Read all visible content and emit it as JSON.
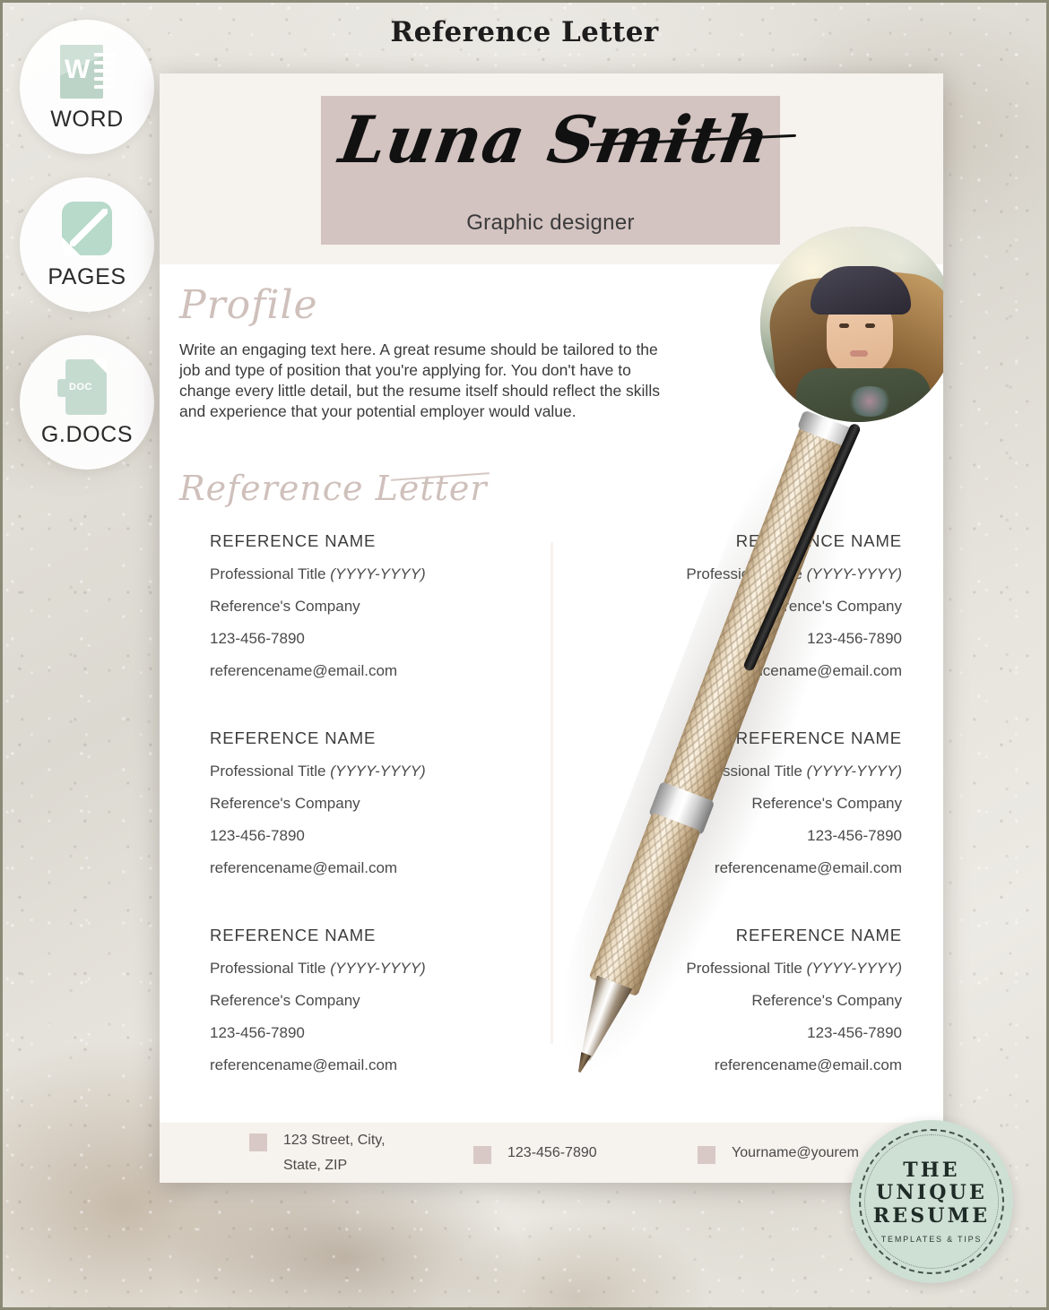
{
  "page": {
    "title": "Reference Letter"
  },
  "badges": [
    {
      "label": "WORD",
      "icon": "word-icon"
    },
    {
      "label": "PAGES",
      "icon": "pages-icon"
    },
    {
      "label": "G.DOCS",
      "icon": "google-docs-icon"
    }
  ],
  "document": {
    "header": {
      "name": "Luna Smith",
      "job_title": "Graphic designer"
    },
    "profile": {
      "heading": "Profile",
      "text": "Write an engaging text here.  A great resume should be tailored to the job and type of position that you're applying for. You don't have to change every little detail, but the resume itself should reflect the skills and experience that your potential employer would value."
    },
    "references_section": {
      "heading": "Reference Letter",
      "entries": [
        {
          "name": "REFERENCE NAME",
          "title": "Professional Title",
          "years": "(YYYY-YYYY)",
          "company": "Reference's Company",
          "phone": "123-456-7890",
          "email": "referencename@email.com"
        },
        {
          "name": "REFERENCE NAME",
          "title": "Professional Title",
          "years": "(YYYY-YYYY)",
          "company": "Reference's Company",
          "phone": "123-456-7890",
          "email": "referencename@email.com"
        },
        {
          "name": "REFERENCE NAME",
          "title": "Professional Title",
          "years": "(YYYY-YYYY)",
          "company": "Reference's Company",
          "phone": "123-456-7890",
          "email": "referencename@email.com"
        },
        {
          "name": "REFERENCE NAME",
          "title": "Professional Title",
          "years": "(YYYY-YYYY)",
          "company": "Reference's Company",
          "phone": "123-456-7890",
          "email": "referencename@email.com"
        },
        {
          "name": "REFERENCE NAME",
          "title": "Professional Title",
          "years": "(YYYY-YYYY)",
          "company": "Reference's Company",
          "phone": "123-456-7890",
          "email": "referencename@email.com"
        },
        {
          "name": "REFERENCE NAME",
          "title": "Professional Title",
          "years": "(YYYY-YYYY)",
          "company": "Reference's Company",
          "phone": "123-456-7890",
          "email": "referencename@email.com"
        }
      ]
    },
    "footer": {
      "address_line1": "123 Street, City,",
      "address_line2": "State, ZIP",
      "phone": "123-456-7890",
      "email": "Yourname@yourem"
    }
  },
  "logo": {
    "line1": "THE",
    "line2": "UNIQUE",
    "line3": "RESUME",
    "tagline": "TEMPLATES & TIPS"
  },
  "colors": {
    "name_band": "#d3c3c1",
    "header_cream": "#f6f2ed",
    "script_pink": "#cfc0bb",
    "footer_square": "#d8c9c7",
    "logo_mint": "#cedfd4",
    "badge_icon_mint": "#bcd4c7"
  }
}
